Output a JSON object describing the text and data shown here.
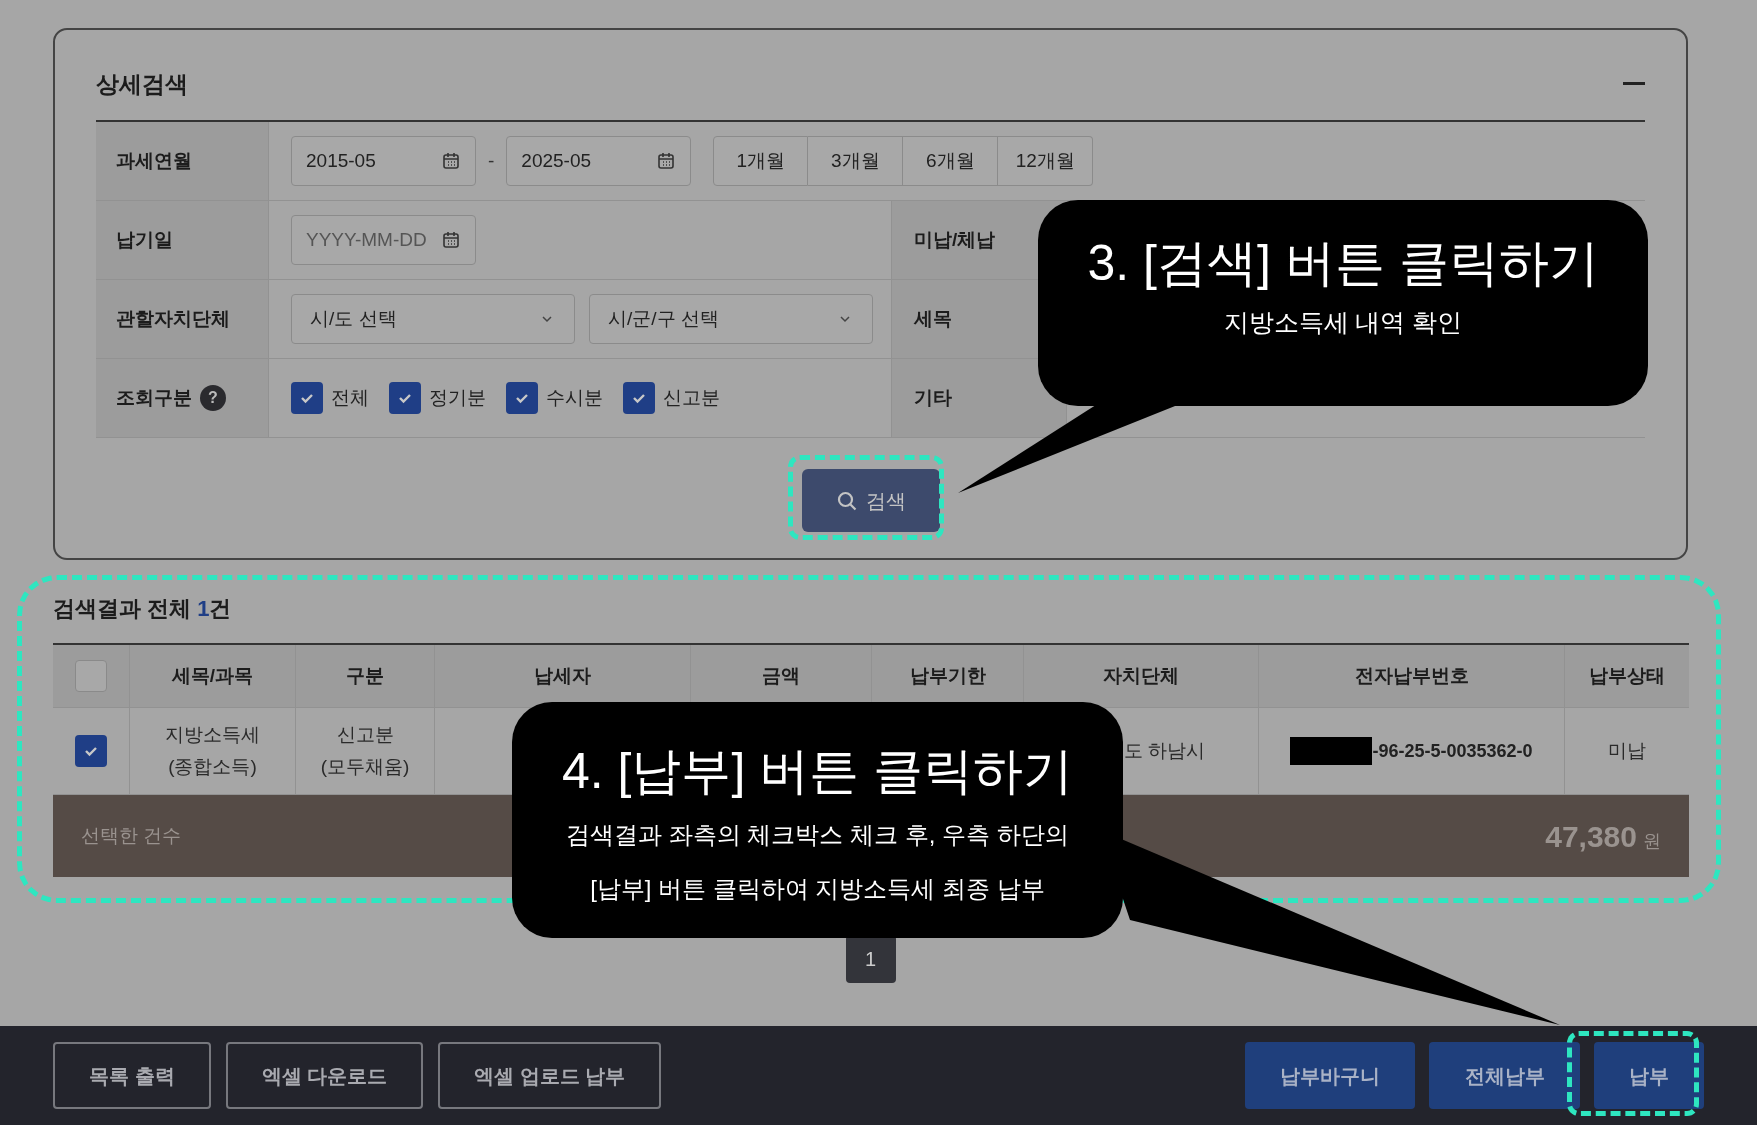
{
  "search_panel": {
    "title": "상세검색",
    "tax_period": {
      "label": "과세연월",
      "from": "2015-05",
      "separator": "-",
      "to": "2025-05",
      "ranges": [
        "1개월",
        "3개월",
        "6개월",
        "12개월"
      ]
    },
    "due_date": {
      "label": "납기일",
      "placeholder": "YYYY-MM-DD"
    },
    "unpaid": {
      "label": "미납/체납"
    },
    "local_gov": {
      "label": "관할자치단체",
      "selects": [
        "시/도 선택",
        "시/군/구 선택"
      ]
    },
    "tax_item": {
      "label": "세목"
    },
    "inquiry_type": {
      "label": "조회구분",
      "help_icon": "?",
      "options": [
        {
          "label": "전체",
          "checked": true
        },
        {
          "label": "정기분",
          "checked": true
        },
        {
          "label": "수시분",
          "checked": true
        },
        {
          "label": "신고분",
          "checked": true
        }
      ]
    },
    "other": {
      "label": "기타"
    },
    "search_button": "검색"
  },
  "results": {
    "title": "검색결과 전체 ",
    "count": "1",
    "count_suffix": "건",
    "select_all": {
      "checked": false
    },
    "columns": [
      "세목/과목",
      "구분",
      "납세자",
      "금액",
      "납부기한",
      "자치단체",
      "전자납부번호",
      "납부상태"
    ],
    "rows": [
      {
        "selected": true,
        "tax_item": [
          "지방소득세",
          "(종합소득)"
        ],
        "type": [
          "신고분",
          "(모두채움)"
        ],
        "local_gov": "도 하남시",
        "payment_number": "-96-25-5-0035362-0",
        "status": "미납"
      }
    ],
    "summary": {
      "label": "선택한 건수",
      "amount": "47,380",
      "unit": "원"
    }
  },
  "pagination": [
    {
      "label": "1",
      "selected": true
    }
  ],
  "bottom_bar": {
    "left_buttons": [
      "목록 출력",
      "엑셀 다운로드",
      "엑셀 업로드 납부"
    ],
    "right_buttons": [
      "납부바구니",
      "전체납부",
      "납부"
    ]
  },
  "callouts": [
    {
      "title": "3. [검색] 버튼 클릭하기",
      "body": [
        "지방소득세 내역 확인"
      ]
    },
    {
      "title": "4. [납부] 버튼 클릭하기",
      "body": [
        "검색결과 좌측의 체크박스 체크 후, 우측 하단의",
        "[납부] 버튼 클릭하여 지방소득세 최종 납부"
      ]
    }
  ]
}
